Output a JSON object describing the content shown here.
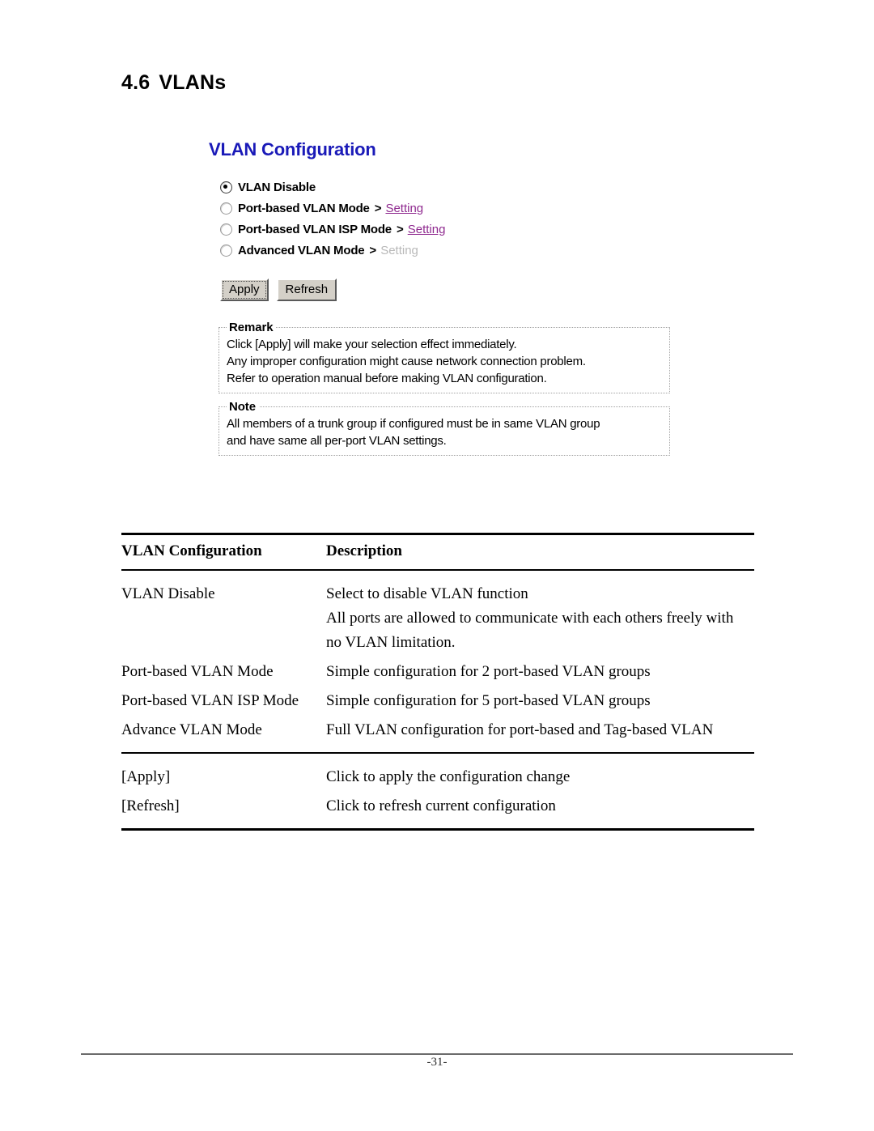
{
  "document": {
    "section_number": "4.6",
    "section_title": "VLANs",
    "page_number": "-31-"
  },
  "screenshot_ui": {
    "title": "VLAN Configuration",
    "radio_options": [
      {
        "label": "VLAN Disable",
        "selected": true,
        "has_link": false,
        "arrow": "",
        "link_text": "",
        "link_enabled": false
      },
      {
        "label": "Port-based VLAN Mode",
        "selected": false,
        "has_link": true,
        "arrow": ">",
        "link_text": "Setting",
        "link_enabled": true
      },
      {
        "label": "Port-based VLAN ISP Mode",
        "selected": false,
        "has_link": true,
        "arrow": ">",
        "link_text": "Setting",
        "link_enabled": true
      },
      {
        "label": "Advanced VLAN Mode",
        "selected": false,
        "has_link": true,
        "arrow": ">",
        "link_text": "Setting",
        "link_enabled": false
      }
    ],
    "buttons": {
      "apply": "Apply",
      "refresh": "Refresh"
    },
    "remark": {
      "legend": "Remark",
      "lines": [
        "Click [Apply] will make your selection effect immediately.",
        "Any improper configuration might cause network connection problem.",
        "Refer to operation manual before making VLAN configuration."
      ]
    },
    "note": {
      "legend": "Note",
      "lines": [
        "All members of a trunk group if configured must be in same VLAN group",
        "and have same all per-port VLAN settings."
      ]
    },
    "colors": {
      "title": "#1a1ab8",
      "link": "#8f2a8f",
      "link_disabled": "#b9b9b9",
      "button_face": "#d4d0c8"
    }
  },
  "desc_table": {
    "headers": {
      "col_a": "VLAN Configuration",
      "col_b": "Description"
    },
    "rows": [
      {
        "name": "VLAN Disable",
        "desc_line1": "Select to disable VLAN function",
        "desc_line2": "All ports are allowed to communicate with each others freely with",
        "desc_line3": "no VLAN limitation."
      },
      {
        "name": "Port-based VLAN Mode",
        "desc_line1": "Simple configuration for 2 port-based VLAN groups",
        "desc_line2": "",
        "desc_line3": ""
      },
      {
        "name": "Port-based VLAN ISP Mode",
        "desc_line1": "Simple configuration for 5 port-based VLAN groups",
        "desc_line2": "",
        "desc_line3": ""
      },
      {
        "name": "Advance VLAN Mode",
        "desc_line1": "Full VLAN configuration for port-based and Tag-based VLAN",
        "desc_line2": "",
        "desc_line3": ""
      }
    ],
    "action_rows": [
      {
        "name": "[Apply]",
        "desc": "Click to apply the configuration change"
      },
      {
        "name": "[Refresh]",
        "desc": "Click to refresh current configuration"
      }
    ]
  }
}
